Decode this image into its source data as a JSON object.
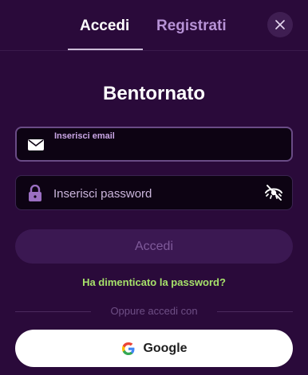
{
  "tabs": {
    "login_label": "Accedi",
    "register_label": "Registrati",
    "active": "login"
  },
  "close": {
    "icon": "close-icon"
  },
  "heading": "Bentornato",
  "email": {
    "label": "Inserisci email",
    "value": "",
    "icon": "email-icon"
  },
  "password": {
    "placeholder": "Inserisci password",
    "value": "",
    "icon": "lock-icon",
    "toggle_icon": "eye-off-icon"
  },
  "submit": {
    "label": "Accedi",
    "enabled": false
  },
  "forgot_password": "Ha dimenticato la password?",
  "divider_text": "Oppure accedi con",
  "google": {
    "label": "Google",
    "icon": "google-icon"
  },
  "colors": {
    "background": "#2a0a3a",
    "accent_green": "#a6e16a",
    "tab_inactive": "#b792d6"
  }
}
